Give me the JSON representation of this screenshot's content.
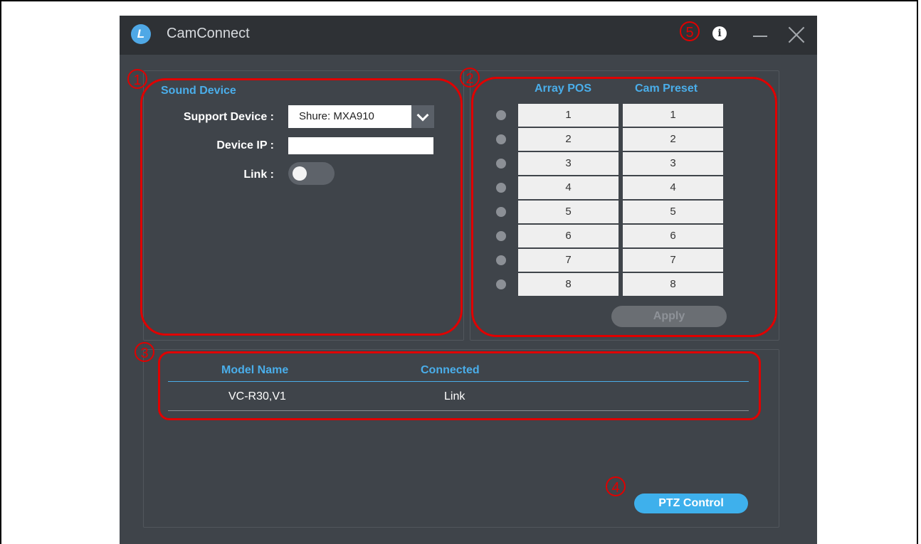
{
  "window": {
    "title": "CamConnect",
    "logo_letter": "L"
  },
  "titlebar": {
    "info_glyph": "i"
  },
  "callouts": [
    "1",
    "2",
    "3",
    "4",
    "5"
  ],
  "sound_device": {
    "heading": "Sound Device",
    "support_device_label": "Support Device :",
    "support_device_value": "Shure: MXA910",
    "device_ip_label": "Device IP :",
    "device_ip_value": "",
    "link_label": "Link :",
    "link_on": false
  },
  "preset_table": {
    "array_pos_header": "Array POS",
    "cam_preset_header": "Cam Preset",
    "rows": [
      {
        "pos": "1",
        "preset": "1"
      },
      {
        "pos": "2",
        "preset": "2"
      },
      {
        "pos": "3",
        "preset": "3"
      },
      {
        "pos": "4",
        "preset": "4"
      },
      {
        "pos": "5",
        "preset": "5"
      },
      {
        "pos": "6",
        "preset": "6"
      },
      {
        "pos": "7",
        "preset": "7"
      },
      {
        "pos": "8",
        "preset": "8"
      }
    ],
    "apply_label": "Apply"
  },
  "camera_list": {
    "model_header": "Model Name",
    "connected_header": "Connected",
    "rows": [
      {
        "model": "VC-R30,V1",
        "connected": "Link"
      }
    ]
  },
  "ptz_button_label": "PTZ Control",
  "colors": {
    "accent": "#4aaeea",
    "callout": "#e00000",
    "window_bg": "#3f444a",
    "titlebar_bg": "#2e3135"
  }
}
